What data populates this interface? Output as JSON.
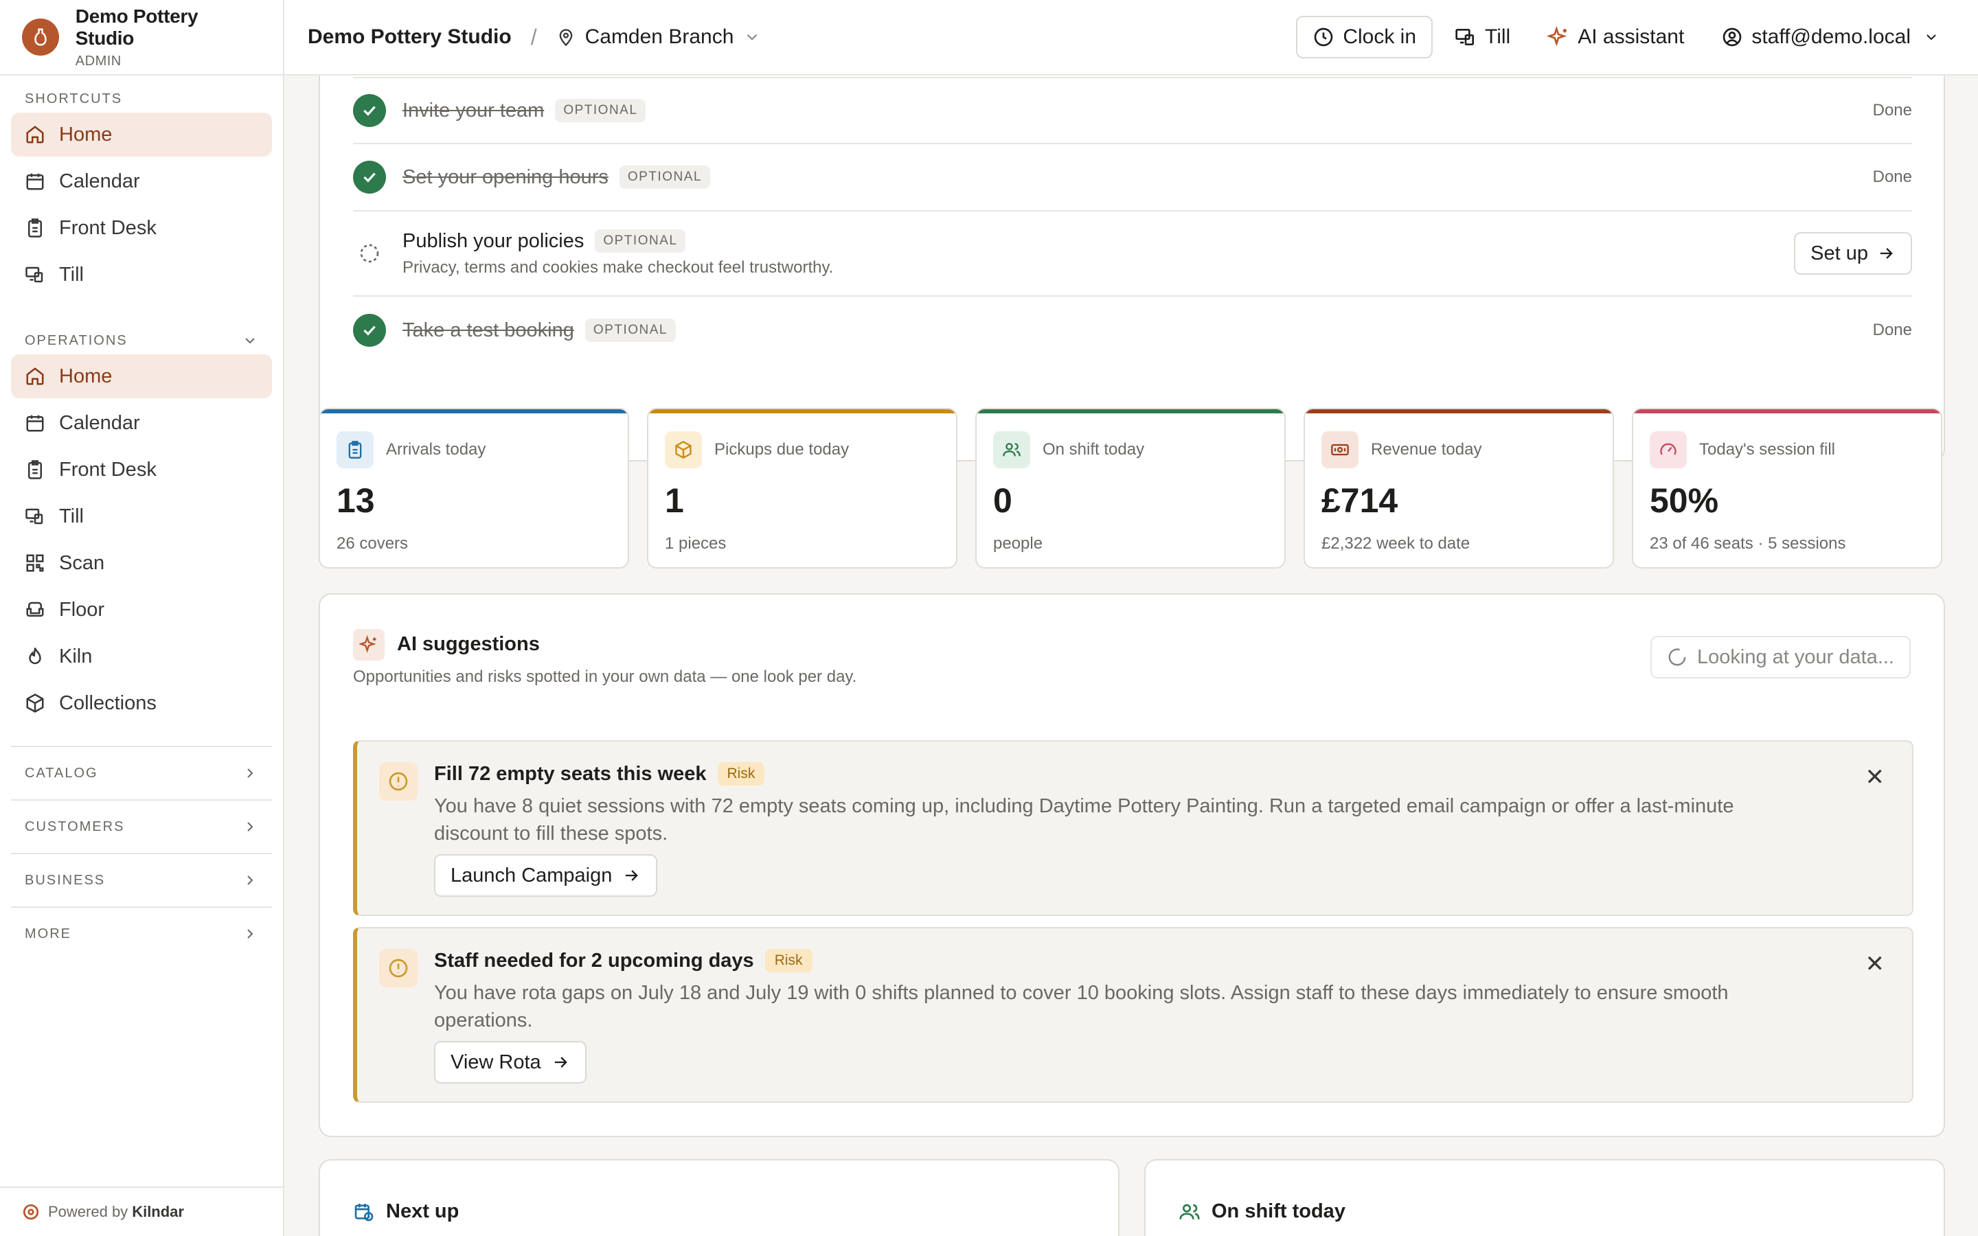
{
  "brand": {
    "name": "Demo Pottery Studio",
    "role": "ADMIN",
    "powered_prefix": "Powered by",
    "powered_name": "Kilndar"
  },
  "sidebar": {
    "shortcuts_label": "SHORTCUTS",
    "shortcuts": [
      {
        "label": "Home",
        "icon": "home-icon",
        "active": true
      },
      {
        "label": "Calendar",
        "icon": "calendar-icon"
      },
      {
        "label": "Front Desk",
        "icon": "clipboard-icon"
      },
      {
        "label": "Till",
        "icon": "till-icon"
      }
    ],
    "operations_label": "OPERATIONS",
    "operations": [
      {
        "label": "Home",
        "icon": "home-icon",
        "active": true
      },
      {
        "label": "Calendar",
        "icon": "calendar-icon"
      },
      {
        "label": "Front Desk",
        "icon": "clipboard-icon"
      },
      {
        "label": "Till",
        "icon": "till-icon"
      },
      {
        "label": "Scan",
        "icon": "qr-icon"
      },
      {
        "label": "Floor",
        "icon": "armchair-icon"
      },
      {
        "label": "Kiln",
        "icon": "flame-icon"
      },
      {
        "label": "Collections",
        "icon": "package-icon"
      }
    ],
    "groups": [
      "CATALOG",
      "CUSTOMERS",
      "BUSINESS",
      "MORE"
    ]
  },
  "topbar": {
    "studio": "Demo Pottery Studio",
    "separator": "/",
    "branch": "Camden Branch",
    "clock_in": "Clock in",
    "till": "Till",
    "ai_assistant": "AI assistant",
    "user": "staff@demo.local"
  },
  "setup": {
    "rows": [
      {
        "title": "Invite your team",
        "tag": "OPTIONAL",
        "status": "Done",
        "done": true
      },
      {
        "title": "Set your opening hours",
        "tag": "OPTIONAL",
        "status": "Done",
        "done": true
      },
      {
        "title": "Publish your policies",
        "tag": "OPTIONAL",
        "subtitle": "Privacy, terms and cookies make checkout feel trustworthy.",
        "action": "Set up",
        "done": false
      },
      {
        "title": "Take a test booking",
        "tag": "OPTIONAL",
        "status": "Done",
        "done": true
      }
    ]
  },
  "stats": [
    {
      "label": "Arrivals today",
      "value": "13",
      "sub": "26 covers",
      "color": "#1f6fa8",
      "icon": "clipboard-icon"
    },
    {
      "label": "Pickups due today",
      "value": "1",
      "sub": "1 pieces",
      "color": "#c98a12",
      "icon": "package-icon"
    },
    {
      "label": "On shift today",
      "value": "0",
      "sub": "people",
      "color": "#2d7a4c",
      "icon": "users-icon"
    },
    {
      "label": "Revenue today",
      "value": "£714",
      "sub": "£2,322 week to date",
      "color": "#9a3f1c",
      "icon": "banknote-icon"
    },
    {
      "label": "Today's session fill",
      "value": "50%",
      "sub": "23 of 46 seats · 5 sessions",
      "color": "#c8475e",
      "icon": "gauge-icon"
    }
  ],
  "ai": {
    "title": "AI suggestions",
    "subtitle": "Opportunities and risks spotted in your own data — one look per day.",
    "status": "Looking at your data...",
    "suggestions": [
      {
        "title": "Fill 72 empty seats this week",
        "badge": "Risk",
        "body": "You have 8 quiet sessions with 72 empty seats coming up, including Daytime Pottery Painting. Run a targeted email campaign or offer a last-minute discount to fill these spots.",
        "action": "Launch Campaign"
      },
      {
        "title": "Staff needed for 2 upcoming days",
        "badge": "Risk",
        "body": "You have rota gaps on July 18 and July 19 with 0 shifts planned to cover 10 booking slots. Assign staff to these days immediately to ensure smooth operations.",
        "action": "View Rota"
      }
    ]
  },
  "bottom": {
    "next_up": "Next up",
    "on_shift": "On shift today"
  },
  "colors": {
    "accent": "#b5562c",
    "success": "#2d7a4c",
    "risk": "#c99a2e"
  }
}
